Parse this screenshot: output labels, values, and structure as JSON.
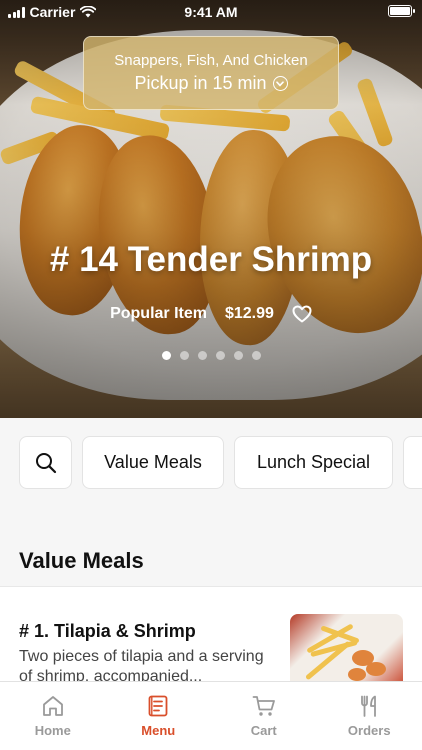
{
  "status_bar": {
    "carrier": "Carrier",
    "time": "9:41 AM"
  },
  "pickup": {
    "store_name": "Snappers, Fish, And Chicken",
    "pickup_time": "Pickup in 15 min"
  },
  "featured": {
    "title": "# 14 Tender Shrimp",
    "badge": "Popular Item",
    "price": "$12.99",
    "carousel_count": 6,
    "carousel_active": 0
  },
  "categories": {
    "items": [
      "Value Meals",
      "Lunch Special"
    ]
  },
  "section": {
    "title": "Value Meals"
  },
  "menu_item": {
    "name": "# 1. Tilapia & Shrimp",
    "description": "Two pieces of tilapia and a serving of shrimp, accompanied..."
  },
  "tabs": [
    {
      "label": "Home",
      "icon": "home-icon",
      "active": false
    },
    {
      "label": "Menu",
      "icon": "menu-icon",
      "active": true
    },
    {
      "label": "Cart",
      "icon": "cart-icon",
      "active": false
    },
    {
      "label": "Orders",
      "icon": "utensils-icon",
      "active": false
    }
  ],
  "colors": {
    "accent": "#d94f2b",
    "tab_inactive": "#9a9a9a",
    "pickup_bg": "#d2b46e"
  }
}
